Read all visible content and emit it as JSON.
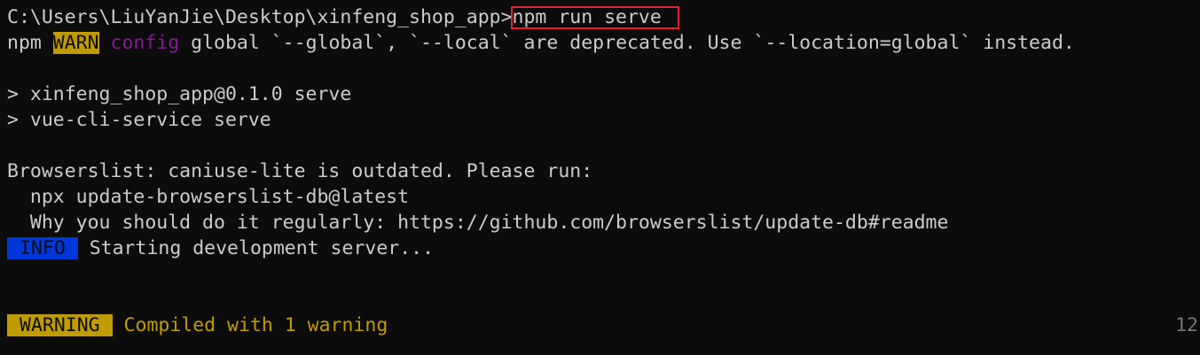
{
  "terminal": {
    "prompt": "C:\\Users\\LiuYanJie\\Desktop\\xinfeng_shop_app>",
    "command": "npm run serve",
    "npm_warn": {
      "prefix": "npm ",
      "badge": "WARN",
      "category": "config",
      "message": " global `--global`, `--local` are deprecated. Use `--location=global` instead."
    },
    "script_line_1": "> xinfeng_shop_app@0.1.0 serve",
    "script_line_2": "> vue-cli-service serve",
    "browserslist_line_1": "Browserslist: caniuse-lite is outdated. Please run:",
    "browserslist_line_2": "  npx update-browserslist-db@latest",
    "browserslist_line_3": "  Why you should do it regularly: https://github.com/browserslist/update-db#readme",
    "info": {
      "badge": "INFO",
      "message": " Starting development server..."
    },
    "warning": {
      "badge": "WARNING",
      "message": " Compiled with 1 warning"
    },
    "line_number": "12"
  },
  "colors": {
    "background": "#0c0c0c",
    "foreground": "#cccccc",
    "warn_yellow": "#c19c00",
    "config_purple": "#881798",
    "info_blue": "#0037da",
    "highlight_red": "#e0242e"
  }
}
